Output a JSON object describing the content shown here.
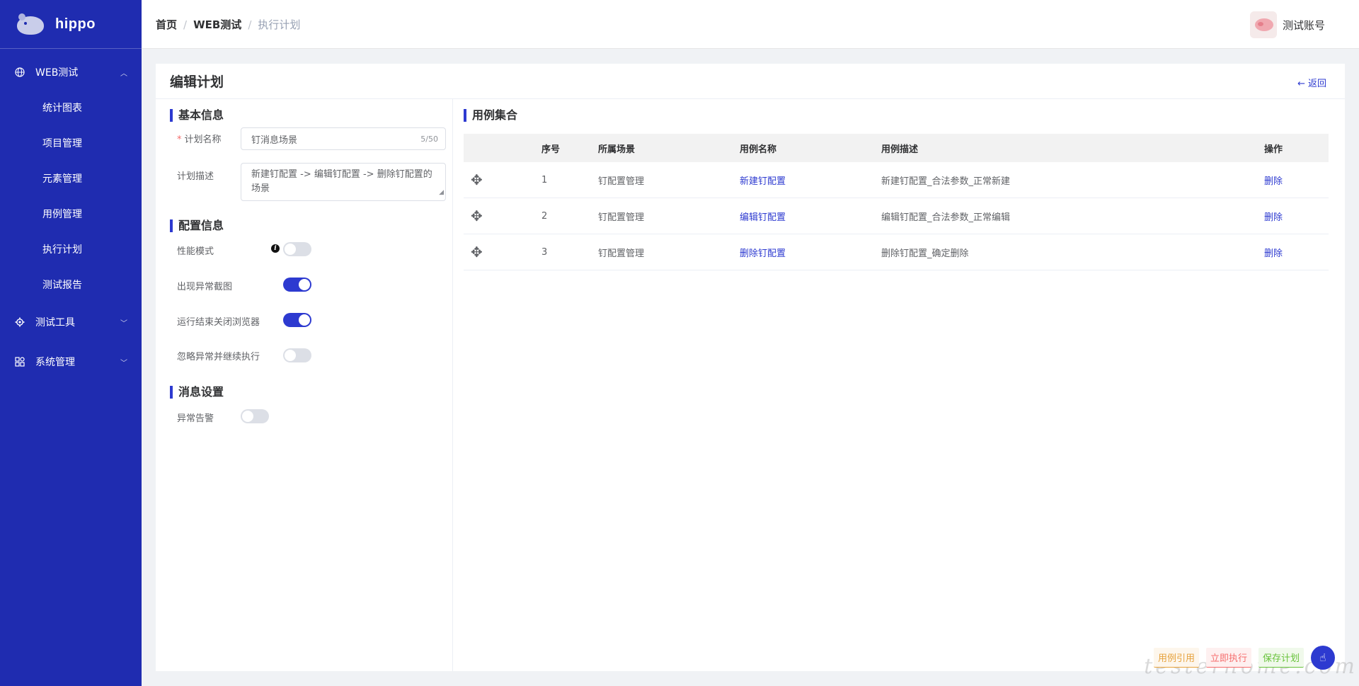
{
  "app": {
    "name": "hippo"
  },
  "sidebar": {
    "groups": [
      {
        "label": "WEB测试",
        "icon": "globe-icon",
        "expanded": true,
        "items": [
          {
            "label": "统计图表"
          },
          {
            "label": "项目管理"
          },
          {
            "label": "元素管理"
          },
          {
            "label": "用例管理"
          },
          {
            "label": "执行计划"
          },
          {
            "label": "测试报告"
          }
        ]
      },
      {
        "label": "测试工具",
        "icon": "gear-icon",
        "expanded": false
      },
      {
        "label": "系统管理",
        "icon": "grid-icon",
        "expanded": false
      }
    ]
  },
  "header": {
    "breadcrumb": {
      "home": "首页",
      "section": "WEB测试",
      "current": "执行计划",
      "separator": "/"
    },
    "user": {
      "name": "测试账号"
    }
  },
  "page": {
    "title": "编辑计划",
    "back_label": "返回"
  },
  "basic_info": {
    "title": "基本信息",
    "name_label": "计划名称",
    "name_value": "钉消息场景",
    "name_count": "5/50",
    "desc_label": "计划描述",
    "desc_value": "新建钉配置 -> 编辑钉配置 -> 删除钉配置的场景"
  },
  "config": {
    "title": "配置信息",
    "options": [
      {
        "label": "性能模式",
        "on": false,
        "has_info": true
      },
      {
        "label": "出现异常截图",
        "on": true
      },
      {
        "label": "运行结束关闭浏览器",
        "on": true
      },
      {
        "label": "忽略异常并继续执行",
        "on": false
      }
    ]
  },
  "message": {
    "title": "消息设置",
    "alert_label": "异常告警",
    "alert_on": false
  },
  "cases": {
    "title": "用例集合",
    "columns": {
      "index": "序号",
      "scene": "所属场景",
      "name": "用例名称",
      "desc": "用例描述",
      "ops": "操作"
    },
    "rows": [
      {
        "index": "1",
        "scene": "钉配置管理",
        "name": "新建钉配置",
        "desc": "新建钉配置_合法参数_正常新建",
        "op": "删除"
      },
      {
        "index": "2",
        "scene": "钉配置管理",
        "name": "编辑钉配置",
        "desc": "编辑钉配置_合法参数_正常编辑",
        "op": "删除"
      },
      {
        "index": "3",
        "scene": "钉配置管理",
        "name": "删除钉配置",
        "desc": "删除钉配置_确定删除",
        "op": "删除"
      }
    ]
  },
  "actions": {
    "cite": "用例引用",
    "run": "立即执行",
    "save": "保存计划",
    "watermark": "testerhome.com"
  },
  "colors": {
    "primary": "#2d3ad0",
    "sidebar": "#1f2cb0"
  }
}
